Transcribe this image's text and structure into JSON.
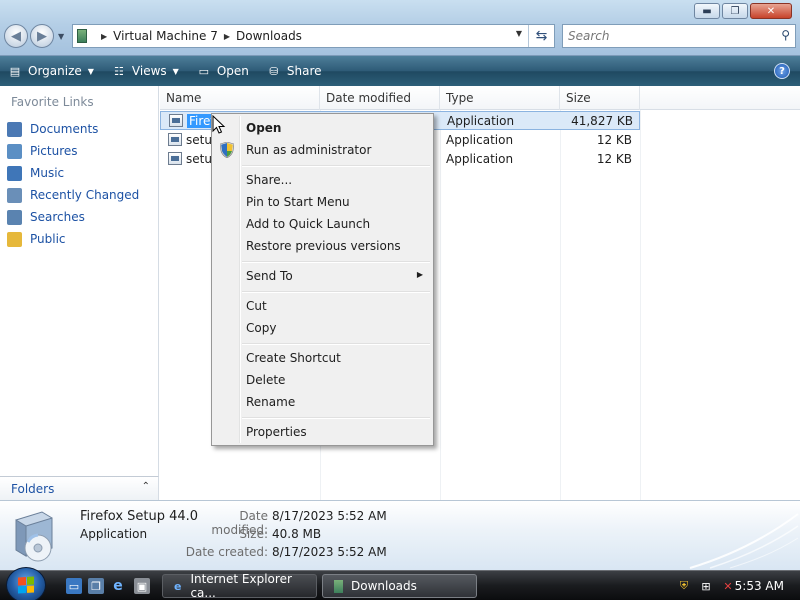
{
  "window": {
    "minimize_icon": "minimize-icon",
    "maximize_icon": "maximize-icon",
    "close_icon": "close-icon"
  },
  "address": {
    "crumbs": [
      "Virtual Machine 7",
      "Downloads"
    ],
    "search_placeholder": "Search"
  },
  "toolbar": {
    "organize": "Organize",
    "views": "Views",
    "open": "Open",
    "share": "Share"
  },
  "nav": {
    "heading": "Favorite Links",
    "items": [
      {
        "label": "Documents",
        "icon": "documents-icon",
        "color": "#4b79b4"
      },
      {
        "label": "Pictures",
        "icon": "pictures-icon",
        "color": "#5b8fc4"
      },
      {
        "label": "Music",
        "icon": "music-icon",
        "color": "#3f76b8"
      },
      {
        "label": "Recently Changed",
        "icon": "recently-changed-icon",
        "color": "#6a8fb8"
      },
      {
        "label": "Searches",
        "icon": "searches-icon",
        "color": "#5a83b0"
      },
      {
        "label": "Public",
        "icon": "public-folder-icon",
        "color": "#e6b83b"
      }
    ],
    "folders": "Folders"
  },
  "columns": [
    "Name",
    "Date modified",
    "Type",
    "Size"
  ],
  "files": [
    {
      "name": "Firef",
      "type": "Application",
      "size": "41,827 KB",
      "selected": true
    },
    {
      "name": "setup",
      "type": "Application",
      "size": "12 KB",
      "selected": false
    },
    {
      "name": "setup",
      "type": "Application",
      "size": "12 KB",
      "selected": false
    }
  ],
  "context_menu": {
    "open": "Open",
    "run_as_admin": "Run as administrator",
    "share": "Share...",
    "pin_start": "Pin to Start Menu",
    "quick_launch": "Add to Quick Launch",
    "restore": "Restore previous versions",
    "send_to": "Send To",
    "cut": "Cut",
    "copy": "Copy",
    "create_shortcut": "Create Shortcut",
    "delete": "Delete",
    "rename": "Rename",
    "properties": "Properties"
  },
  "details": {
    "name": "Firefox Setup 44.0",
    "kind": "Application",
    "date_modified_label": "Date modified:",
    "date_modified": "8/17/2023 5:52 AM",
    "size_label": "Size:",
    "size": "40.8 MB",
    "date_created_label": "Date created:",
    "date_created": "8/17/2023 5:52 AM"
  },
  "taskbar": {
    "tasks": [
      "Internet Explorer ca...",
      "Downloads"
    ],
    "clock": "5:53 AM"
  }
}
